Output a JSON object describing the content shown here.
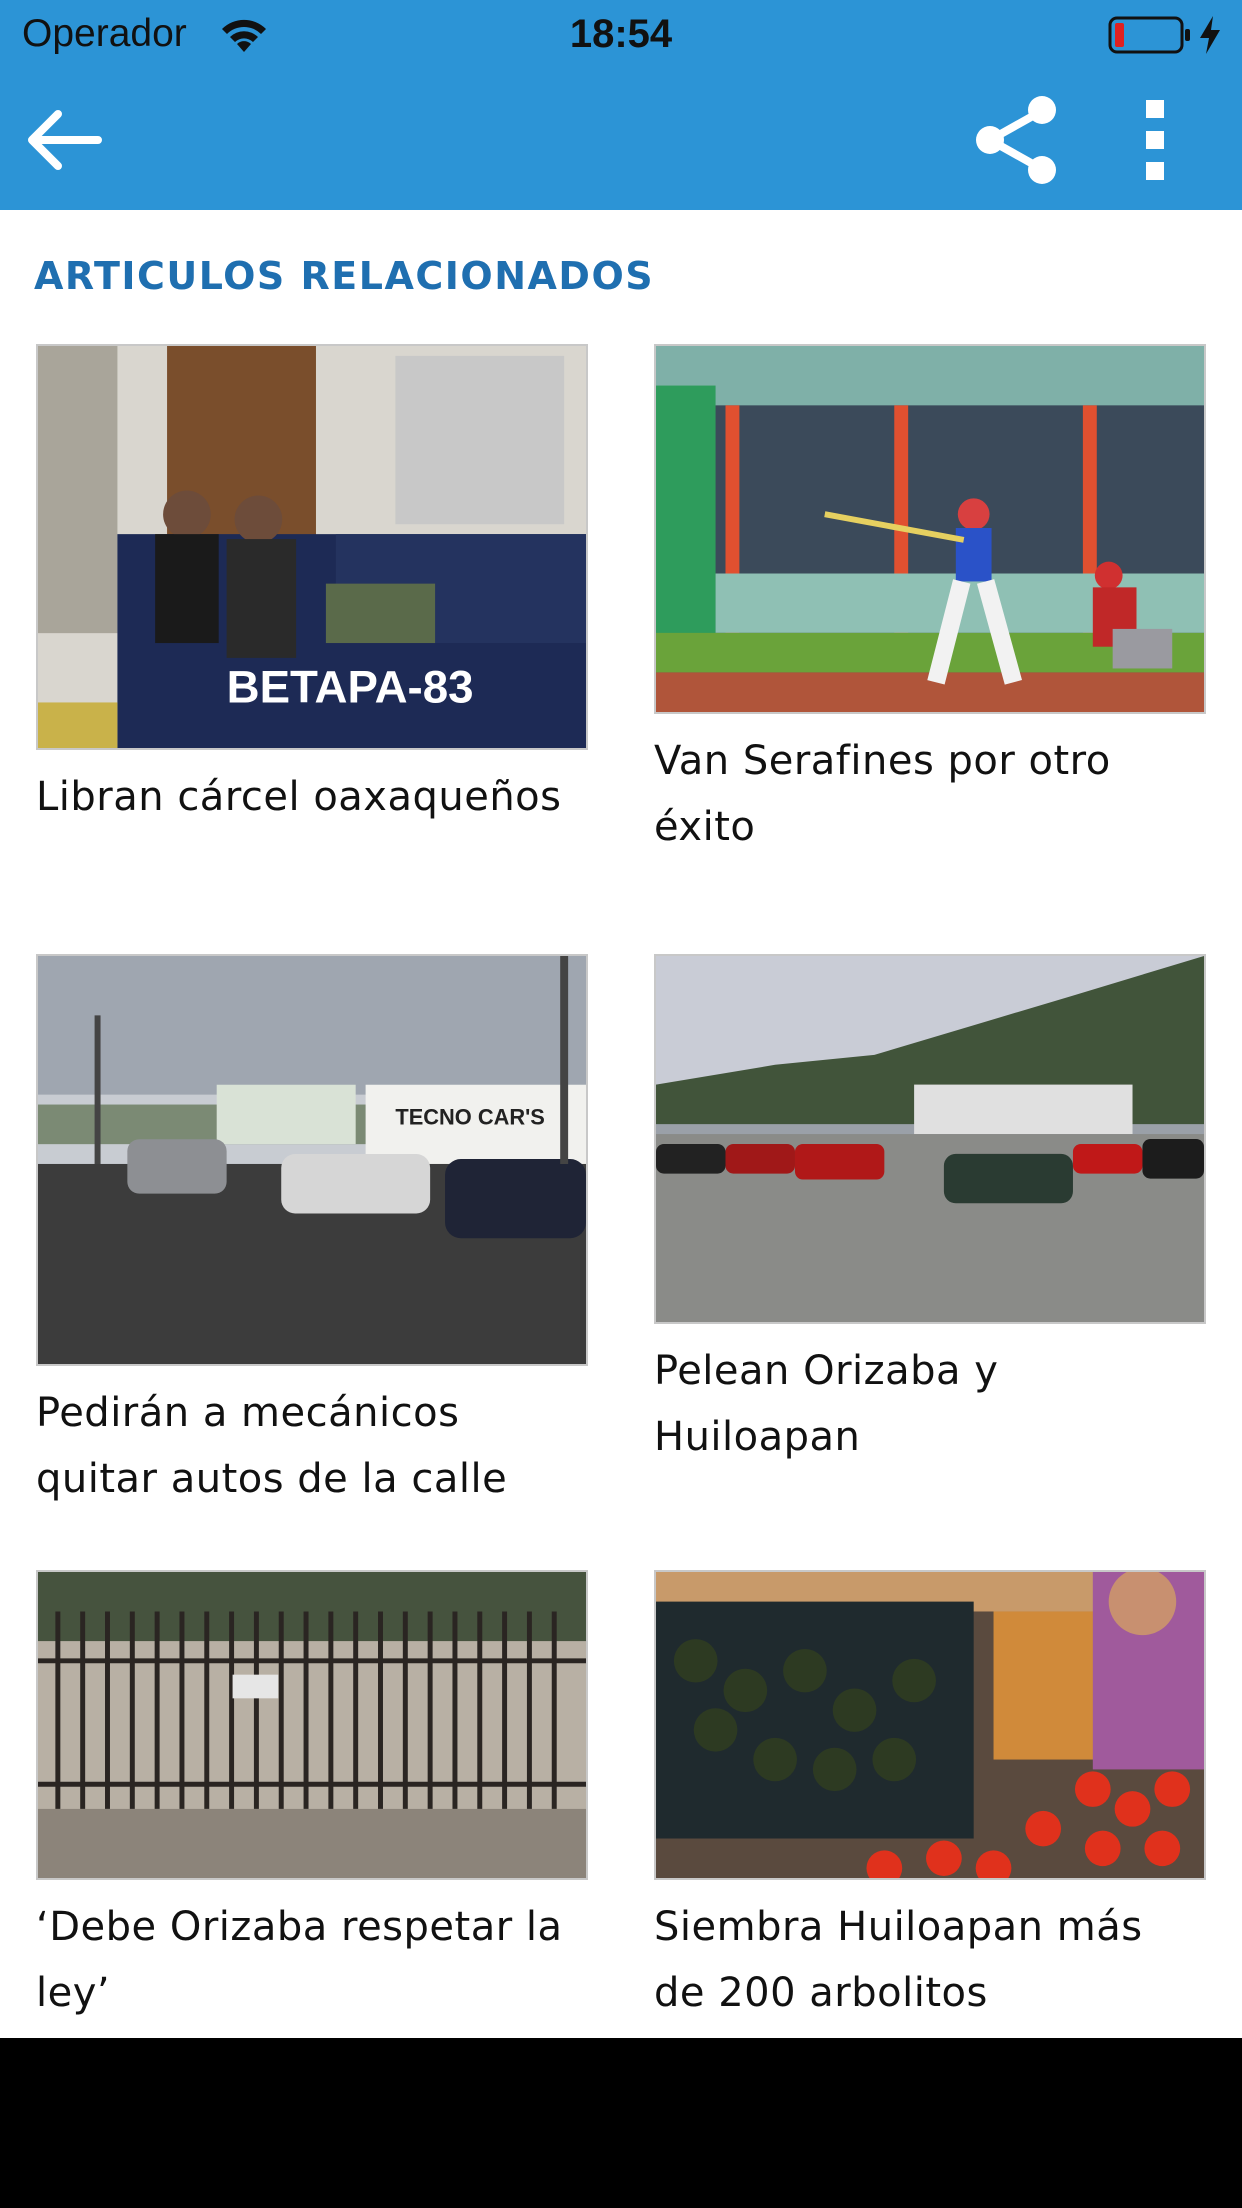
{
  "status_bar": {
    "carrier": "Operador",
    "time": "18:54"
  },
  "toolbar": {
    "back_icon": "arrow-left-icon",
    "share_icon": "share-icon",
    "more_icon": "more-vertical-icon"
  },
  "colors": {
    "header": "#2c94d6",
    "section_title": "#1f6fb0",
    "caption": "#111111"
  },
  "related": {
    "title": "ARTICULOS RELACIONADOS",
    "articles": [
      {
        "title": "Libran cárcel oaxaqueños",
        "image": "police-truck-photo"
      },
      {
        "title": "Van Serafines por otro éxito",
        "image": "baseball-game-photo"
      },
      {
        "title": "Pedirán a mecánicos quitar autos de la calle",
        "image": "street-cars-photo"
      },
      {
        "title": "Pelean Orizaba y Huiloapan",
        "image": "parking-lot-mountains-photo"
      },
      {
        "title": "‘Debe Orizaba respetar la ley’",
        "image": "iron-gate-photo"
      },
      {
        "title": "Siembra Huiloapan más de 200 arbolitos",
        "image": "market-produce-photo"
      }
    ]
  }
}
